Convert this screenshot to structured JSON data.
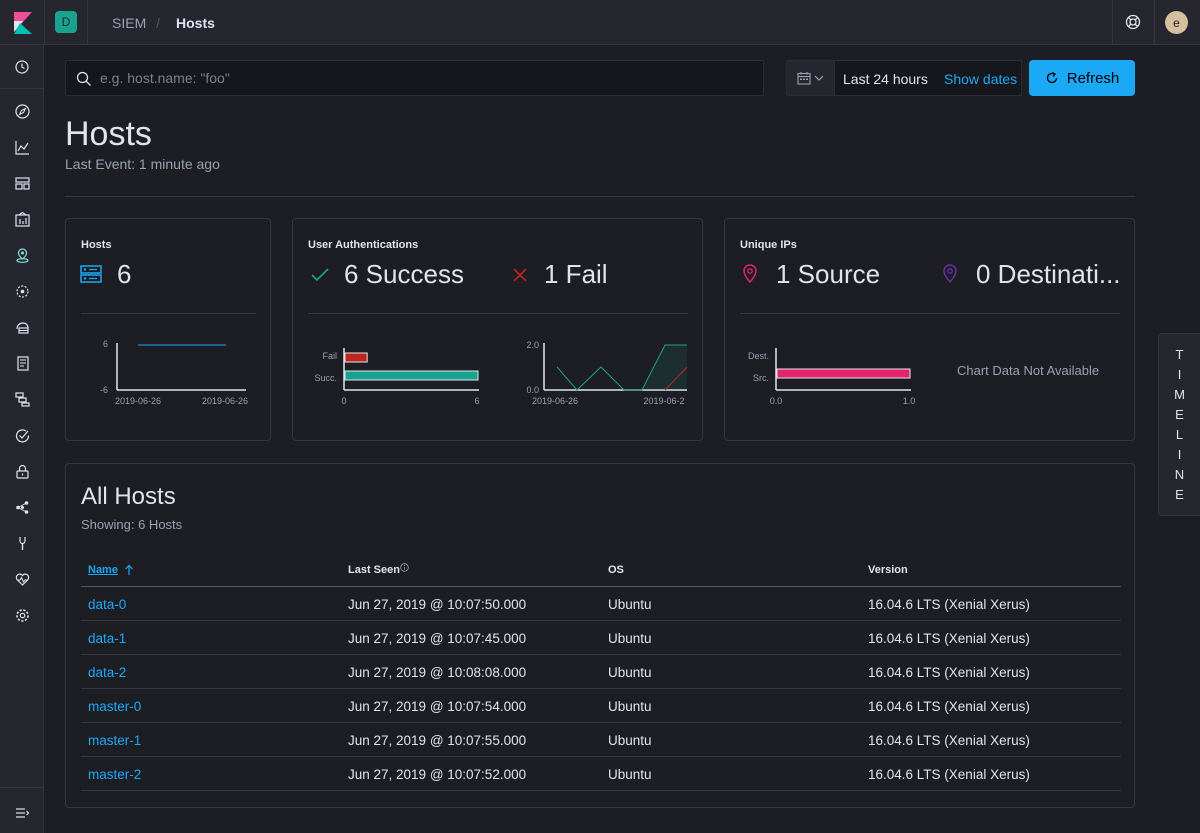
{
  "breadcrumbs": {
    "root": "SIEM",
    "separator": "/",
    "current": "Hosts"
  },
  "space": {
    "initial": "D"
  },
  "user": {
    "initial": "e"
  },
  "search": {
    "placeholder": "e.g. host.name: \"foo\"",
    "value": ""
  },
  "datepicker": {
    "range_label": "Last 24 hours",
    "show_dates_label": "Show dates"
  },
  "refresh": {
    "label": "Refresh"
  },
  "page": {
    "title": "Hosts",
    "last_event": "Last Event: 1 minute ago"
  },
  "kpis": {
    "hosts": {
      "title": "Hosts",
      "value": "6",
      "chart": {
        "y_ticks": [
          "6",
          "-6"
        ],
        "x_ticks": [
          "2019-06-26",
          "2019-06-26"
        ]
      }
    },
    "auth": {
      "title": "User Authentications",
      "success": "6 Success",
      "fail": "1 Fail",
      "bar": {
        "categories": [
          "Fail",
          "Succ."
        ],
        "values": [
          1,
          6
        ],
        "x_ticks": [
          "0",
          "6"
        ],
        "fail_color": "#bd271e",
        "success_color": "#19a38e"
      },
      "area": {
        "y_ticks": [
          "2.0",
          "0.0"
        ],
        "x_ticks": [
          "2019-06-26",
          "2019-06-2"
        ]
      }
    },
    "ips": {
      "title": "Unique IPs",
      "source": "1 Source",
      "destination": "0 Destinati...",
      "bar": {
        "categories": [
          "Dest.",
          "Src."
        ],
        "values": [
          0,
          1
        ],
        "x_ticks": [
          "0.0",
          "1.0"
        ],
        "source_color": "#e4236f"
      },
      "not_available": "Chart Data Not Available"
    }
  },
  "timeline": {
    "letters": [
      "T",
      "I",
      "M",
      "E",
      "L",
      "I",
      "N",
      "E"
    ]
  },
  "hosts_table": {
    "title": "All Hosts",
    "subtitle": "Showing: 6 Hosts",
    "columns": {
      "name": "Name",
      "last_seen": "Last Seen",
      "os": "OS",
      "version": "Version"
    },
    "rows": [
      {
        "name": "data-0",
        "last_seen": "Jun 27, 2019 @ 10:07:50.000",
        "os": "Ubuntu",
        "version": "16.04.6 LTS (Xenial Xerus)"
      },
      {
        "name": "data-1",
        "last_seen": "Jun 27, 2019 @ 10:07:45.000",
        "os": "Ubuntu",
        "version": "16.04.6 LTS (Xenial Xerus)"
      },
      {
        "name": "data-2",
        "last_seen": "Jun 27, 2019 @ 10:08:08.000",
        "os": "Ubuntu",
        "version": "16.04.6 LTS (Xenial Xerus)"
      },
      {
        "name": "master-0",
        "last_seen": "Jun 27, 2019 @ 10:07:54.000",
        "os": "Ubuntu",
        "version": "16.04.6 LTS (Xenial Xerus)"
      },
      {
        "name": "master-1",
        "last_seen": "Jun 27, 2019 @ 10:07:55.000",
        "os": "Ubuntu",
        "version": "16.04.6 LTS (Xenial Xerus)"
      },
      {
        "name": "master-2",
        "last_seen": "Jun 27, 2019 @ 10:07:52.000",
        "os": "Ubuntu",
        "version": "16.04.6 LTS (Xenial Xerus)"
      }
    ]
  },
  "colors": {
    "accent": "#1ba9f5",
    "success": "#19a38e",
    "danger": "#bd271e",
    "pink": "#e4236f",
    "purple": "#6a2fa6"
  }
}
